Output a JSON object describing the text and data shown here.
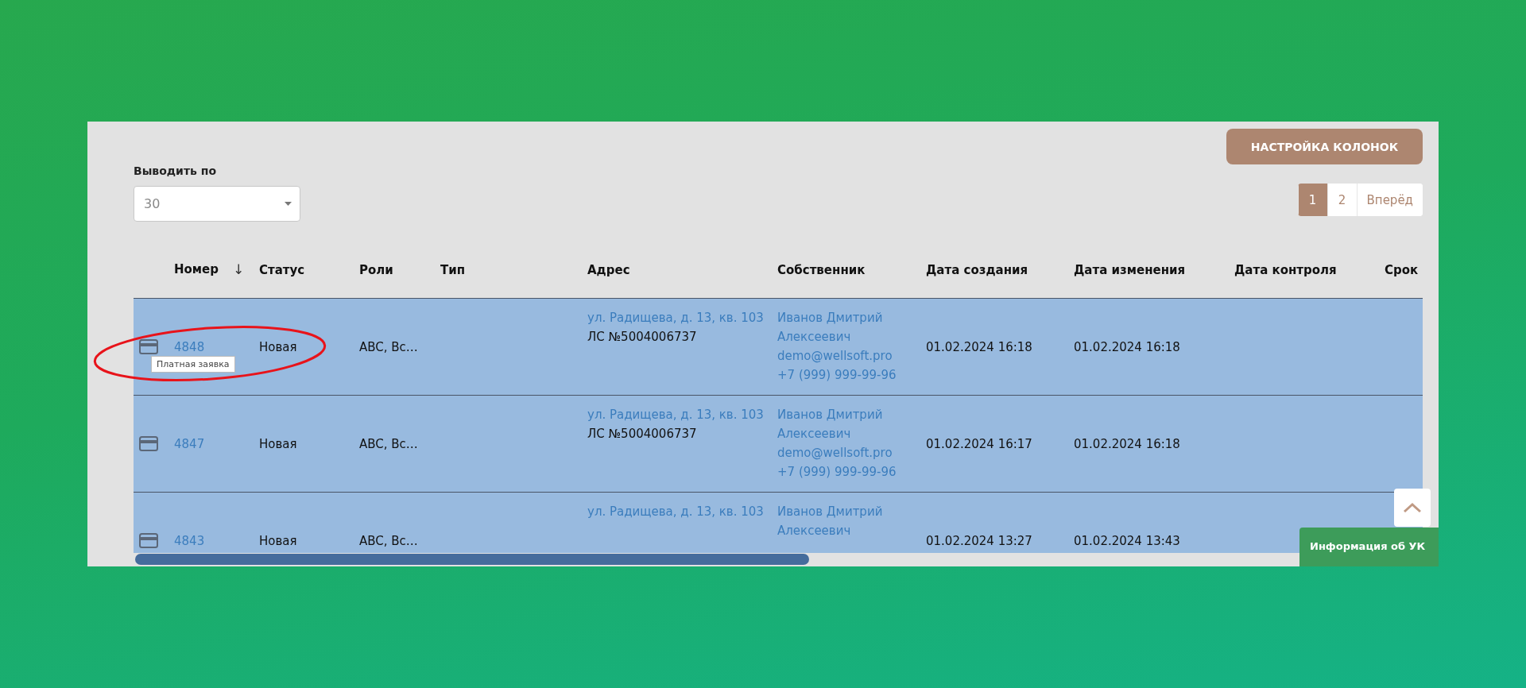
{
  "page_size": {
    "label": "Выводить по",
    "value": "30"
  },
  "column_settings_button": "НАСТРОЙКА КОЛОНОК",
  "pagination": [
    {
      "label": "1",
      "selected": true
    },
    {
      "label": "2",
      "selected": false
    },
    {
      "label": "Вперёд",
      "selected": false
    }
  ],
  "table": {
    "columns": [
      {
        "label": "Номер",
        "sort_indicator": "↓"
      },
      {
        "label": "Статус"
      },
      {
        "label": "Роли"
      },
      {
        "label": "Тип"
      },
      {
        "label": "Адрес"
      },
      {
        "label": "Собственник"
      },
      {
        "label": "Дата создания"
      },
      {
        "label": "Дата изменения"
      },
      {
        "label": "Дата контроля"
      },
      {
        "label": "Срок"
      }
    ],
    "rows": [
      {
        "selected": true,
        "number": "4848",
        "tooltip": "Платная заявка",
        "status": "Новая",
        "roles": "ABC, Вс…",
        "address": "ул. Радищева, д. 13, кв. 103",
        "account": "ЛС №5004006737",
        "owner": "Иванов Дмитрий Алексеевич",
        "email": "demo@wellsoft.pro",
        "phone": "+7 (999) 999-99-96",
        "created": "01.02.2024 16:18",
        "modified": "01.02.2024 16:18"
      },
      {
        "selected": true,
        "number": "4847",
        "status": "Новая",
        "roles": "ABC, Вс…",
        "address": "ул. Радищева, д. 13, кв. 103",
        "account": "ЛС №5004006737",
        "owner": "Иванов Дмитрий Алексеевич",
        "email": "demo@wellsoft.pro",
        "phone": "+7 (999) 999-99-96",
        "created": "01.02.2024 16:17",
        "modified": "01.02.2024 16:18"
      },
      {
        "selected": true,
        "number": "4843",
        "status": "Новая",
        "roles": "ABC, Вс…",
        "address": "ул. Радищева, д. 13, кв. 103",
        "owner": "Иванов Дмитрий Алексеевич",
        "created": "01.02.2024 13:27",
        "modified": "01.02.2024 13:43"
      }
    ]
  },
  "info_tab": "Информация об УК"
}
